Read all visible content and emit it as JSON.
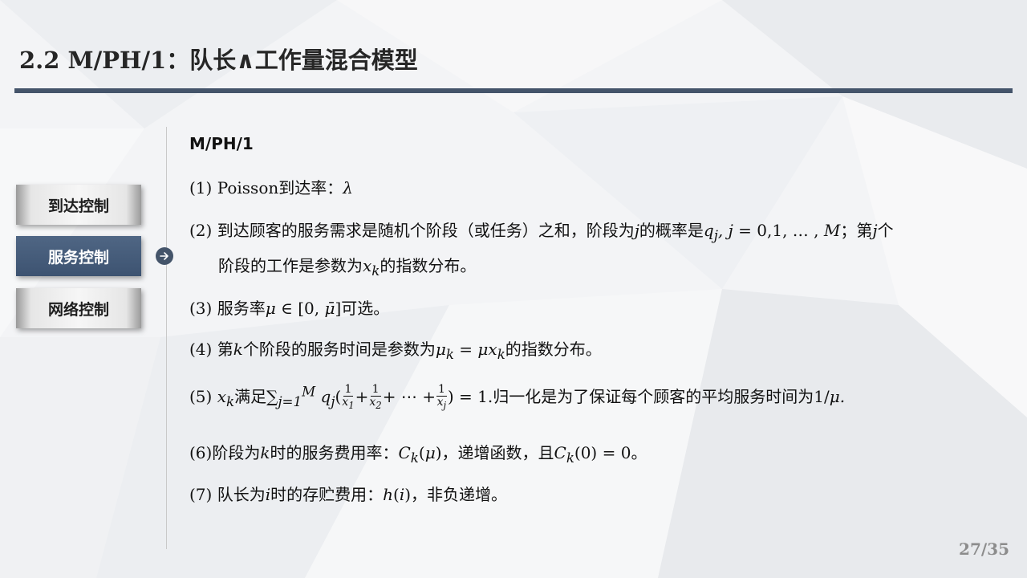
{
  "slide": {
    "title": "2.2  M/PH/1：队长∧工作量混合模型",
    "page_number": "27/35"
  },
  "sidebar": {
    "items": [
      {
        "label": "到达控制",
        "state": "inactive"
      },
      {
        "label": "服务控制",
        "state": "active"
      },
      {
        "label": "网络控制",
        "state": "inactive"
      }
    ],
    "active_arrow_icon": "arrow-right-circle-icon"
  },
  "content": {
    "heading": "M/PH/1",
    "items": {
      "i1": {
        "num": "(1)",
        "t1": "Poisson到达率："
      },
      "i2": {
        "num": "(2)",
        "t1": "到达顾客的服务需求是随机个阶段（或任务）之和，阶段为",
        "t2": "的概率是",
        "t3": "；第",
        "t4": "个",
        "t5": "阶段的工作是参数为",
        "t6": "的指数分布。"
      },
      "i3": {
        "num": "(3)",
        "t1": "服务率",
        "t2": "可选。"
      },
      "i4": {
        "num": "(4)",
        "t1": "第",
        "t2": "个阶段的服务时间是参数为",
        "t3": "的指数分布。"
      },
      "i5": {
        "num": "(5)",
        "t1": "满足",
        "t2": "归一化是为了保证每个顾客的平均服务时间为"
      },
      "i6": {
        "num": "(6)",
        "t1": "阶段为",
        "t2": "时的服务费用率：",
        "t3": "，递增函数，且",
        "t4": "。"
      },
      "i7": {
        "num": "(7)",
        "t1": "队长为",
        "t2": "时的存贮费用：",
        "t3": "，非负递增。"
      }
    }
  },
  "colors": {
    "title_rule": "#44546a",
    "active_nav": "#44546a",
    "page_number": "#8c8c8c"
  }
}
